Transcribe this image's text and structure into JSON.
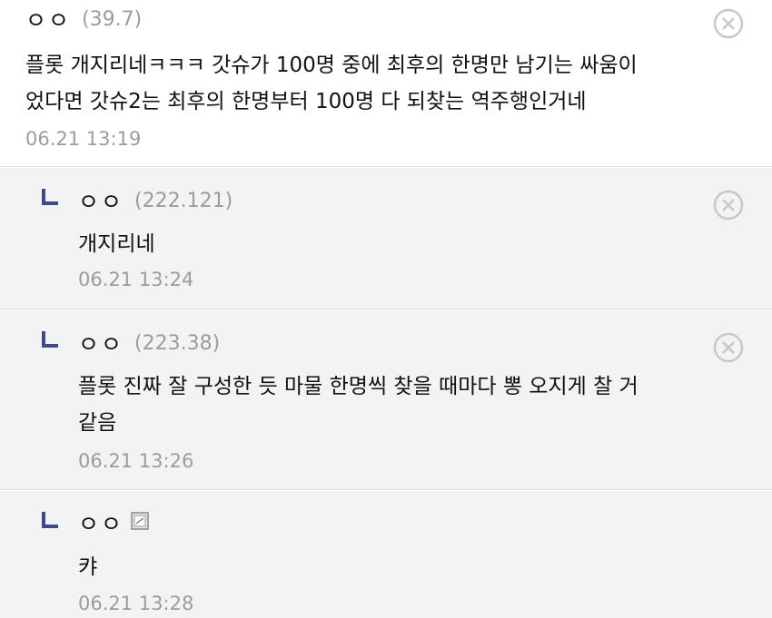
{
  "comments": [
    {
      "nickname": "ㅇㅇ",
      "ip": "(39.7)",
      "text_lines": [
        "플롯 개지리네ㅋㅋㅋ 갓슈가 100명 중에 최후의 한명만 남기는 싸움이",
        "었다면 갓슈2는 최후의 한명부터 100명 다 되찾는 역주행인거네"
      ],
      "time": "06.21 13:19"
    },
    {
      "nickname": "ㅇㅇ",
      "ip": "(222.121)",
      "text_lines": [
        "개지리네"
      ],
      "time": "06.21 13:24"
    },
    {
      "nickname": "ㅇㅇ",
      "ip": "(223.38)",
      "text_lines": [
        "플롯 진짜 잘 구성한 듯 마물 한명씩 찾을 때마다 뽕 오지게 찰 거",
        "같음"
      ],
      "time": "06.21 13:26"
    },
    {
      "nickname": "ㅇㅇ",
      "text_lines": [
        "캬"
      ],
      "time": "06.21 13:28"
    }
  ],
  "icons": {
    "delete": "close-circle-icon",
    "reply": "reply-arrow-icon",
    "member": "gallog-member-icon"
  },
  "colors": {
    "reply_bg": "#f3f3f6",
    "reply_arrow": "#3a4a8c",
    "meta_text": "#9c9c9c",
    "divider": "#dcdde3"
  }
}
